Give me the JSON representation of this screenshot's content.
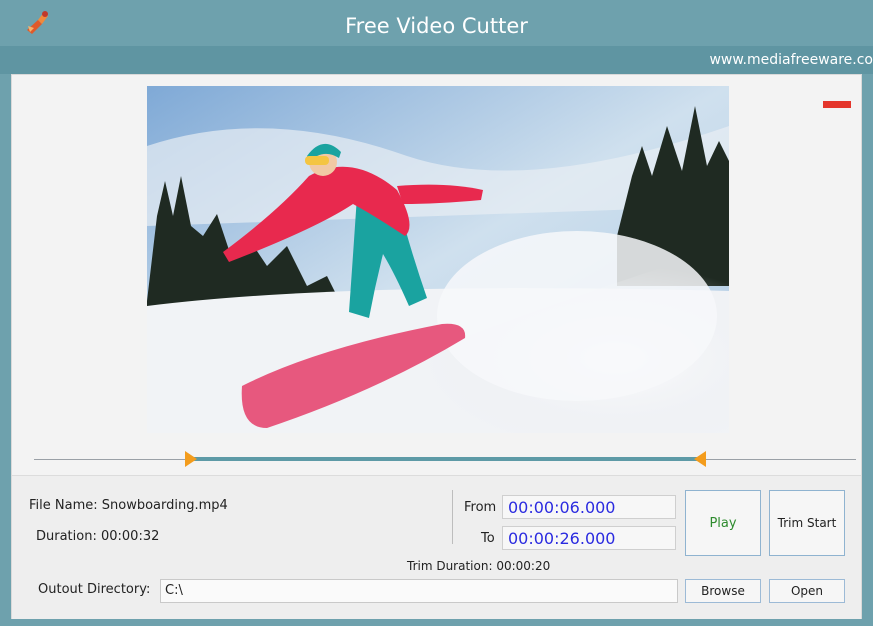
{
  "window": {
    "title": "Free Video Cutter",
    "url": "www.mediafreeware.co"
  },
  "video": {
    "description_icon": "snowboarder-video-frame"
  },
  "trim_slider": {
    "start_fraction": 0.1875,
    "end_fraction": 0.8125
  },
  "file": {
    "name_label": "File Name: Snowboarding.mp4",
    "duration_label": "Duration: 00:00:32"
  },
  "range": {
    "from_label": "From",
    "from_value": "00:00:06.000",
    "to_label": "To",
    "to_value": "00:00:26.000",
    "trim_duration_label": "Trim Duration: 00:00:20"
  },
  "buttons": {
    "play": "Play",
    "trim_start": "Trim Start",
    "browse": "Browse",
    "open": "Open"
  },
  "output": {
    "label": "Outout Directory:",
    "value": "C:\\"
  },
  "colors": {
    "title_bar": "#6ea1ad",
    "play_text": "#2e8b2e",
    "time_text": "#2b2be0",
    "handle": "#f39c1c",
    "red_mark": "#e4352b"
  }
}
